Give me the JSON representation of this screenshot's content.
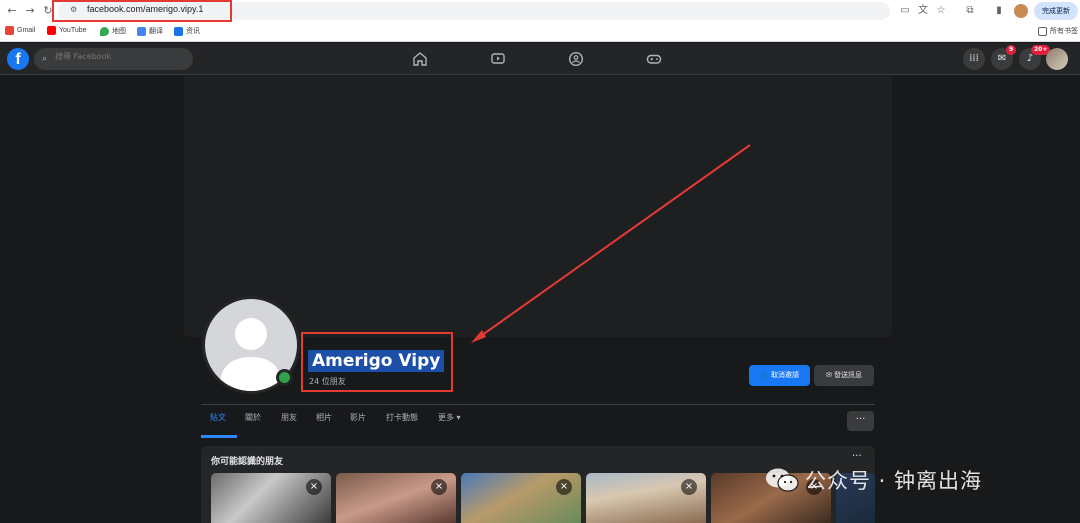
{
  "browser": {
    "url": "facebook.com/amerigo.vipy.1",
    "update_label": "完成更新",
    "bookmarks": [
      "Gmail",
      "YouTube",
      "地图",
      "翻译",
      "资讯"
    ],
    "all_bookmarks": "所有书签"
  },
  "fb": {
    "logo": "f",
    "search_placeholder": "搜尋 Facebook",
    "messenger_badge": "9",
    "notif_badge": "20+"
  },
  "profile": {
    "name": "Amerigo Vipy",
    "friends": "24 位朋友",
    "unfriend_label": "取消邀請",
    "message_label": "發送訊息"
  },
  "tabs": [
    "貼文",
    "關於",
    "朋友",
    "相片",
    "影片",
    "打卡動態",
    "更多"
  ],
  "tab_more_dots": "···",
  "suggestions": {
    "title": "你可能認識的朋友",
    "more": "···"
  },
  "watermark": "公众号 · 钟离出海",
  "colors": {
    "fb_blue": "#1877f2",
    "online": "#31a24c",
    "highlight_box": "#e53935",
    "dark_bg": "#18191a"
  }
}
